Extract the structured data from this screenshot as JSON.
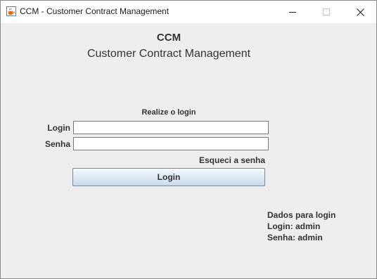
{
  "window": {
    "title": "CCM - Customer Contract Management",
    "app_icon": "java-cup-icon",
    "controls": {
      "minimize": "minimize-icon",
      "maximize": "maximize-icon",
      "close": "close-icon"
    }
  },
  "header": {
    "title": "CCM",
    "subtitle": "Customer Contract Management"
  },
  "form": {
    "caption": "Realize o login",
    "login_label": "Login",
    "login_value": "",
    "password_label": "Senha",
    "password_value": "",
    "forgot_link": "Esqueci a senha",
    "submit_label": "Login"
  },
  "info": {
    "heading": "Dados para login",
    "login_hint": "Login: admin",
    "password_hint": "Senha: admin"
  }
}
